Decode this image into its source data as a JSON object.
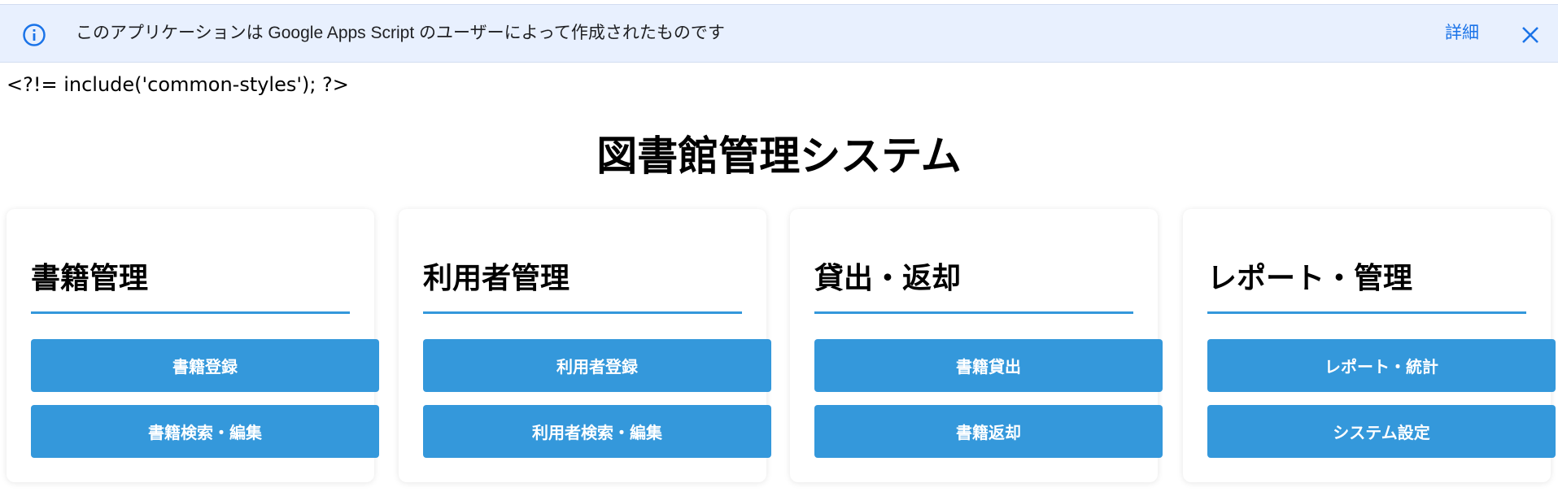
{
  "banner": {
    "message": "このアプリケーションは Google Apps Script のユーザーによって作成されたものです",
    "details_label": "詳細",
    "info_icon": "info-icon",
    "close_icon": "close-icon",
    "background": "#e8f0fe",
    "accent": "#1a73e8"
  },
  "include_text": "<?!= include('common-styles'); ?>",
  "page_title": "図書館管理システム",
  "accent_color": "#3498db",
  "cards": [
    {
      "title": "書籍管理",
      "buttons": [
        "書籍登録",
        "書籍検索・編集"
      ]
    },
    {
      "title": "利用者管理",
      "buttons": [
        "利用者登録",
        "利用者検索・編集"
      ]
    },
    {
      "title": "貸出・返却",
      "buttons": [
        "書籍貸出",
        "書籍返却"
      ]
    },
    {
      "title": "レポート・管理",
      "buttons": [
        "レポート・統計",
        "システム設定"
      ]
    }
  ]
}
